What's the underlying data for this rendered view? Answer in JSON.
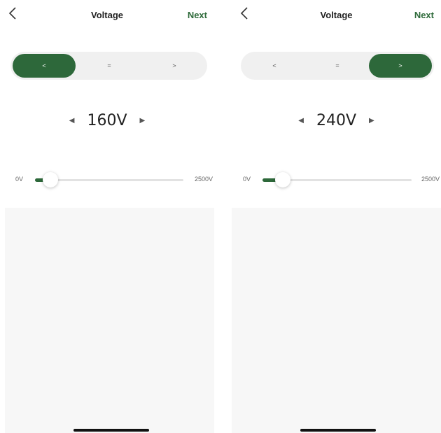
{
  "screens": [
    {
      "header": {
        "title": "Voltage",
        "next_label": "Next"
      },
      "segments": [
        "<",
        "=",
        ">"
      ],
      "selected_segment": "<",
      "value": {
        "display": "160V",
        "volts": 160
      },
      "slider": {
        "min_label": "0V",
        "max_label": "2500V",
        "min": 0,
        "max": 2500,
        "value": 160
      }
    },
    {
      "header": {
        "title": "Voltage",
        "next_label": "Next"
      },
      "segments": [
        "<",
        "=",
        ">"
      ],
      "selected_segment": ">",
      "value": {
        "display": "240V",
        "volts": 240
      },
      "slider": {
        "min_label": "0V",
        "max_label": "2500V",
        "min": 0,
        "max": 2500,
        "value": 240
      }
    }
  ],
  "colors": {
    "accent": "#2d683a",
    "next_text": "#2f6b3b",
    "segment_bg": "#f0f0f0",
    "panel_bg": "#f7f7f7"
  },
  "icons": {
    "back": "chevron-left-icon",
    "decrease": "triangle-left-icon",
    "increase": "triangle-right-icon"
  }
}
